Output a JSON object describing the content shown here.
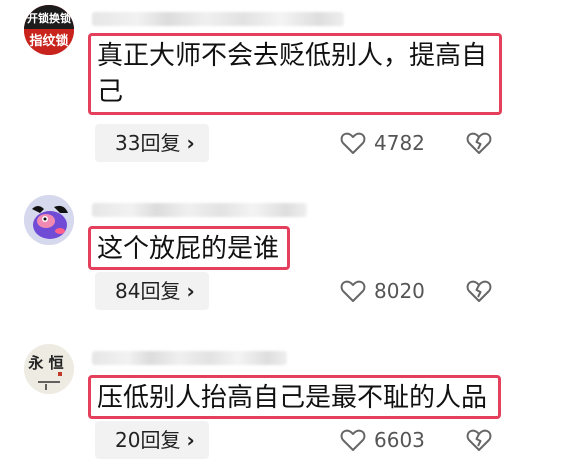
{
  "comments": [
    {
      "avatar_icon": "locksmith-avatar-icon",
      "avatar_text_top": "开锁换锁",
      "avatar_text_bottom": "指纹锁",
      "text": "真正大师不会去贬低别人，提高自己",
      "replies_label": "33回复",
      "likes": "4782"
    },
    {
      "avatar_icon": "cartoon-avatar-icon",
      "text": "这个放屁的是谁",
      "replies_label": "84回复",
      "likes": "8020"
    },
    {
      "avatar_icon": "calligraphy-avatar-icon",
      "avatar_text": "永 恒",
      "text": "压低别人抬高自己是最不耻的人品",
      "replies_label": "20回复",
      "likes": "6603"
    }
  ],
  "icons": {
    "reply_chevron": "chevron-right-icon",
    "like": "heart-icon",
    "dislike": "broken-heart-icon"
  },
  "colors": {
    "highlight_border": "#e4405c",
    "reply_button_bg": "#f2f2f2"
  }
}
